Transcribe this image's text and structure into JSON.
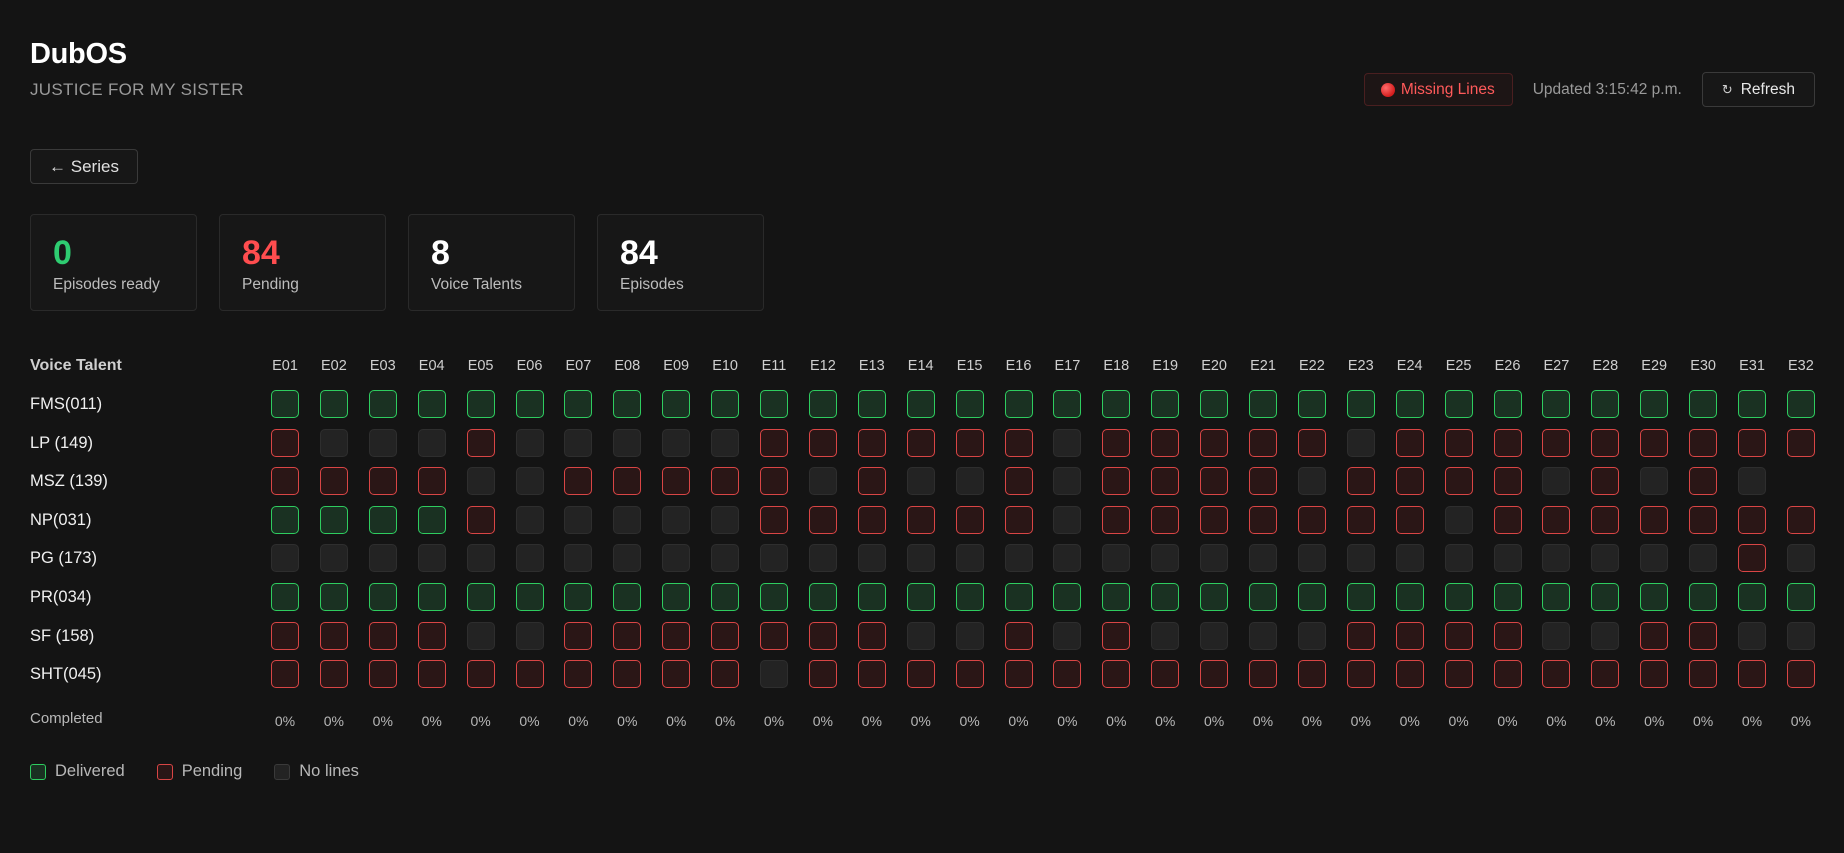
{
  "app": {
    "title": "DubOS",
    "subtitle": "JUSTICE FOR MY SISTER"
  },
  "header": {
    "missing_label": "Missing Lines",
    "updated_text": "Updated 3:15:42 p.m.",
    "refresh_label": "Refresh",
    "refresh_icon": "↻"
  },
  "nav": {
    "back_label": "← Series"
  },
  "stats": [
    {
      "value": "0",
      "label": "Episodes ready",
      "color": "#2ecc71"
    },
    {
      "value": "84",
      "label": "Pending",
      "color": "#ff4d4f"
    },
    {
      "value": "8",
      "label": "Voice Talents",
      "color": "#ffffff"
    },
    {
      "value": "84",
      "label": "Episodes",
      "color": "#ffffff"
    }
  ],
  "grid": {
    "header_label": "Voice Talent",
    "episodes": [
      "E01",
      "E02",
      "E03",
      "E04",
      "E05",
      "E06",
      "E07",
      "E08",
      "E09",
      "E10",
      "E11",
      "E12",
      "E13",
      "E14",
      "E15",
      "E16",
      "E17",
      "E18",
      "E19",
      "E20",
      "E21",
      "E22",
      "E23",
      "E24",
      "E25",
      "E26",
      "E27",
      "E28",
      "E29",
      "E30",
      "E31",
      "E32"
    ],
    "talents": [
      {
        "name": "FMS(011)",
        "cells": "dddddddddddddddddddddddddddddddd"
      },
      {
        "name": "LP (149)",
        "cells": "pnnnpnnnnnppppppnpppppnppppppppp"
      },
      {
        "name": "MSZ (139)",
        "cells": "ppppnnpppppnpnnpnppppnppppnpnpn"
      },
      {
        "name": "NP(031)",
        "cells": "ddddpnnnnnppppppnpppppppnppppppp"
      },
      {
        "name": "PG (173)",
        "cells": "nnnnnnnnnnnnnnnnnnnnnnnnnnnnnnpn"
      },
      {
        "name": "PR(034)",
        "cells": "dddddddddddddddddddddddddddddddd"
      },
      {
        "name": "SF (158)",
        "cells": "ppppnnpppppppnnpnpnnnnppppnnppnn"
      },
      {
        "name": "SHT(045)",
        "cells": "ppppppppppnppppppppppppppppppppp"
      }
    ],
    "completed_label": "Completed",
    "completed_pcts": [
      "0%",
      "0%",
      "0%",
      "0%",
      "0%",
      "0%",
      "0%",
      "0%",
      "0%",
      "0%",
      "0%",
      "0%",
      "0%",
      "0%",
      "0%",
      "0%",
      "0%",
      "0%",
      "0%",
      "0%",
      "0%",
      "0%",
      "0%",
      "0%",
      "0%",
      "0%",
      "0%",
      "0%",
      "0%",
      "0%",
      "0%",
      "0%"
    ]
  },
  "legend": [
    {
      "key": "d",
      "label": "Delivered"
    },
    {
      "key": "p",
      "label": "Pending"
    },
    {
      "key": "n",
      "label": "No lines"
    }
  ]
}
